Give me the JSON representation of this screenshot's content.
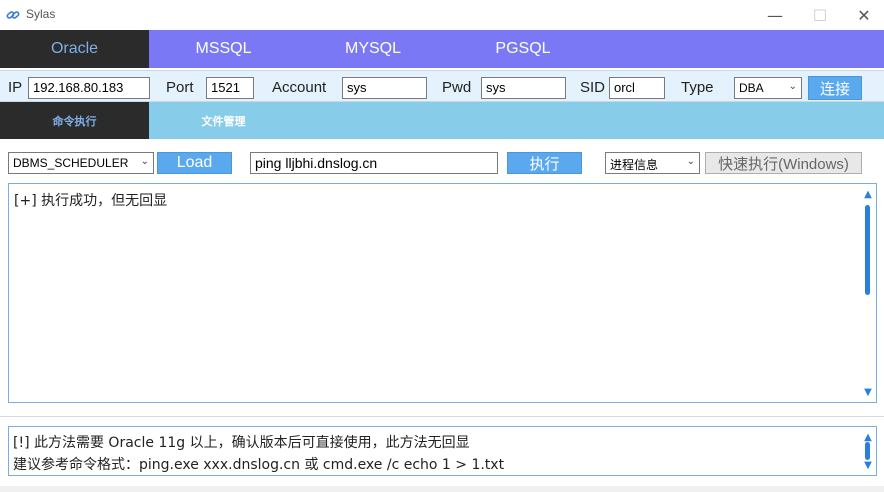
{
  "window": {
    "title": "Sylas",
    "minimize_glyph": "—",
    "maximize_glyph": "☐",
    "close_glyph": "✕"
  },
  "db_tabs": [
    "Oracle",
    "MSSQL",
    "MYSQL",
    "PGSQL"
  ],
  "connection": {
    "ip_label": "IP",
    "ip_value": "192.168.80.183",
    "port_label": "Port",
    "port_value": "1521",
    "account_label": "Account",
    "account_value": "sys",
    "pwd_label": "Pwd",
    "pwd_value": "sys",
    "sid_label": "SID",
    "sid_value": "orcl",
    "type_label": "Type",
    "type_value": "DBA",
    "connect_label": "连接"
  },
  "sub_tabs": [
    "命令执行",
    "文件管理"
  ],
  "action": {
    "method_value": "DBMS_SCHEDULER",
    "load_label": "Load",
    "command_value": "ping lljbhi.dnslog.cn",
    "execute_label": "执行",
    "quick_select_value": "进程信息",
    "quick_exec_label": "快速执行(Windows)"
  },
  "output": {
    "text": "[+] 执行成功，但无回显"
  },
  "hint": {
    "line1": "[!] 此方法需要 Oracle 11g 以上，确认版本后可直接使用，此方法无回显",
    "line2": " 建议参考命令格式：ping.exe xxx.dnslog.cn 或 cmd.exe /c echo 1 > 1.txt"
  },
  "colors": {
    "db_tab_bar": "#7b78f5",
    "active_tab_bg": "#2b2b2b",
    "active_tab_text": "#7faee8",
    "sub_tab_bar": "#87cde9",
    "button_blue": "#5aa8ee",
    "scroll_accent": "#2a7de1"
  },
  "icons": {
    "app": "link-icon",
    "dropdown": "chevron-down-icon",
    "scroll_up": "chevron-up-icon",
    "scroll_down": "chevron-down-icon"
  }
}
